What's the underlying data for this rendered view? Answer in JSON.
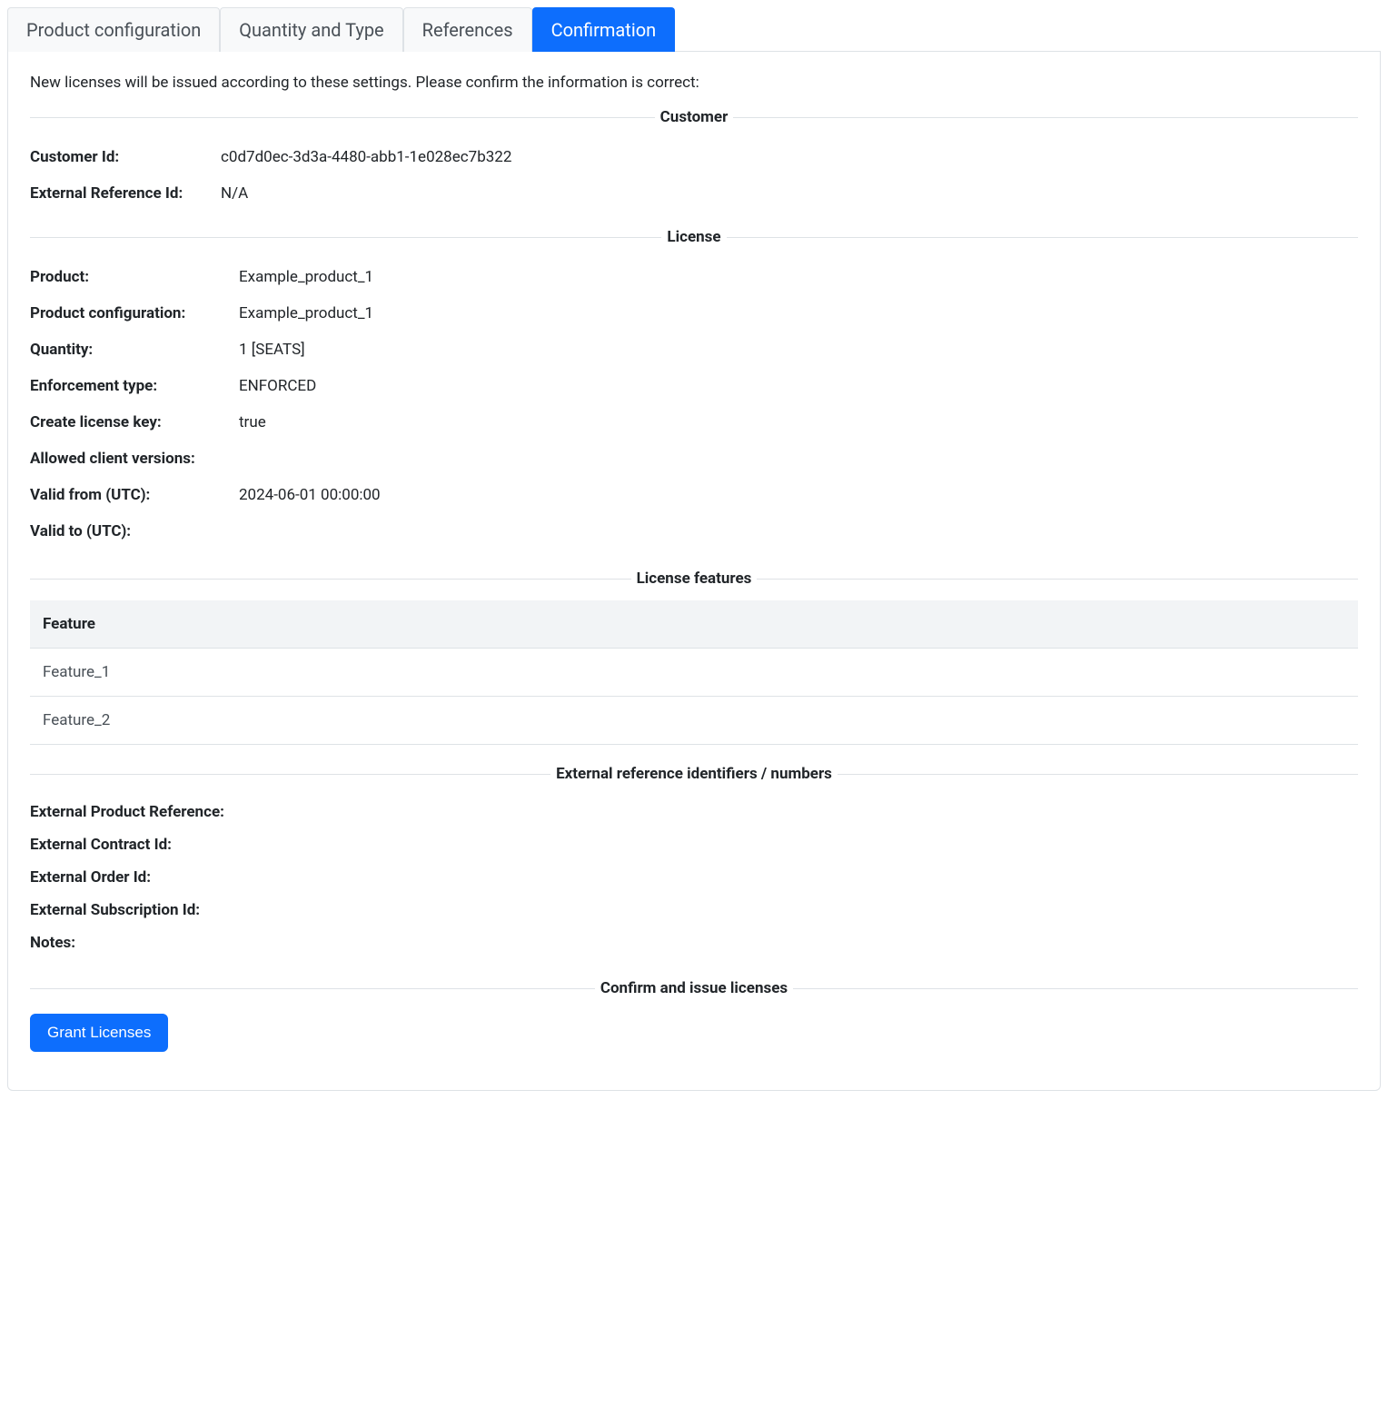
{
  "tabs": [
    {
      "label": "Product configuration",
      "active": false
    },
    {
      "label": "Quantity and Type",
      "active": false
    },
    {
      "label": "References",
      "active": false
    },
    {
      "label": "Confirmation",
      "active": true
    }
  ],
  "intro": "New licenses will be issued according to these settings. Please confirm the information is correct:",
  "sections": {
    "customer": {
      "legend": "Customer",
      "customer_id_label": "Customer Id:",
      "customer_id_value": "c0d7d0ec-3d3a-4480-abb1-1e028ec7b322",
      "external_ref_label": "External Reference Id:",
      "external_ref_value": "N/A"
    },
    "license": {
      "legend": "License",
      "product_label": "Product:",
      "product_value": "Example_product_1",
      "product_config_label": "Product configuration:",
      "product_config_value": "Example_product_1",
      "quantity_label": "Quantity:",
      "quantity_value": "1 [SEATS]",
      "enforcement_label": "Enforcement type:",
      "enforcement_value": "ENFORCED",
      "create_key_label": "Create license key:",
      "create_key_value": "true",
      "allowed_versions_label": "Allowed client versions:",
      "allowed_versions_value": "",
      "valid_from_label": "Valid from (UTC):",
      "valid_from_value": "2024-06-01 00:00:00",
      "valid_to_label": "Valid to (UTC):",
      "valid_to_value": ""
    },
    "features": {
      "legend": "License features",
      "header": "Feature",
      "rows": [
        "Feature_1",
        "Feature_2"
      ]
    },
    "external": {
      "legend": "External reference identifiers / numbers",
      "product_ref_label": "External Product Reference:",
      "product_ref_value": "",
      "contract_id_label": "External Contract Id:",
      "contract_id_value": "",
      "order_id_label": "External Order Id:",
      "order_id_value": "",
      "subscription_id_label": "External Subscription Id:",
      "subscription_id_value": "",
      "notes_label": "Notes:",
      "notes_value": ""
    },
    "confirm": {
      "legend": "Confirm and issue licenses",
      "button_label": "Grant Licenses"
    }
  }
}
